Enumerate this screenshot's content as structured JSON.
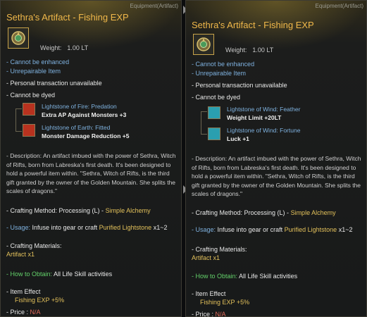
{
  "panels": [
    {
      "category": "Equipment(Artifact)",
      "title": "Sethra's Artifact - Fishing EXP",
      "weight_label": "Weight:",
      "weight_value": "1.00 LT",
      "enhance": "- Cannot be enhanced",
      "repair": "- Unrepairable Item",
      "transaction": "- Personal transaction unavailable",
      "dye": "- Cannot be dyed",
      "lightstones": [
        {
          "name": "Lightstone of Fire: Predation",
          "effect": "Extra AP Against Monsters +3",
          "color": "#c0392b"
        },
        {
          "name": "Lightstone of Earth: Fitted",
          "effect": "Monster Damage Reduction +5",
          "color": "#c0392b"
        }
      ],
      "description": "- Description: An artifact imbued with the power of Sethra, Witch of Rifts, born from Labreska's first death. It's been designed to hold a powerful item within. \"Sethra, Witch of Rifts, is the third gift granted by the owner of the Golden Mountain. She splits the scales of dragons.\"",
      "crafting_method_label": "- Crafting Method: Processing (L) - ",
      "crafting_method_value": "Simple Alchemy",
      "usage_label": "- Usage:",
      "usage_text": "Infuse into gear or craft",
      "usage_item": "Purified Lightstone",
      "usage_qty": "x1~2",
      "materials_label": "- Crafting Materials:",
      "materials_value": "Artifact x1",
      "obtain_label": "- How to Obtain:",
      "obtain_value": "All Life Skill activities",
      "effect_label": "- Item Effect",
      "effect_value": "Fishing EXP +5%",
      "price_label": "- Price :",
      "price_value": "N/A"
    },
    {
      "category": "Equipment(Artifact)",
      "title": "Sethra's Artifact - Fishing EXP",
      "weight_label": "Weight:",
      "weight_value": "1.00 LT",
      "enhance": "- Cannot be enhanced",
      "repair": "- Unrepairable Item",
      "transaction": "- Personal transaction unavailable",
      "dye": "- Cannot be dyed",
      "lightstones": [
        {
          "name": "Lightstone of Wind: Feather",
          "effect": "Weight Limit +20LT",
          "color": "#2bb3c0"
        },
        {
          "name": "Lightstone of Wind: Fortune",
          "effect": "Luck +1",
          "color": "#2bb3c0"
        }
      ],
      "description": "- Description: An artifact imbued with the power of Sethra, Witch of Rifts, born from Labreska's first death. It's been designed to hold a powerful item within. \"Sethra, Witch of Rifts, is the third gift granted by the owner of the Golden Mountain. She splits the scales of dragons.\"",
      "crafting_method_label": "- Crafting Method: Processing (L) - ",
      "crafting_method_value": "Simple Alchemy",
      "usage_label": "- Usage:",
      "usage_text": "Infuse into gear or craft",
      "usage_item": "Purified Lightstone",
      "usage_qty": "x1~2",
      "materials_label": "- Crafting Materials:",
      "materials_value": "Artifact x1",
      "obtain_label": "- How to Obtain:",
      "obtain_value": "All Life Skill activities",
      "effect_label": "- Item Effect",
      "effect_value": "Fishing EXP +5%",
      "price_label": "- Price :",
      "price_value": "N/A"
    }
  ]
}
